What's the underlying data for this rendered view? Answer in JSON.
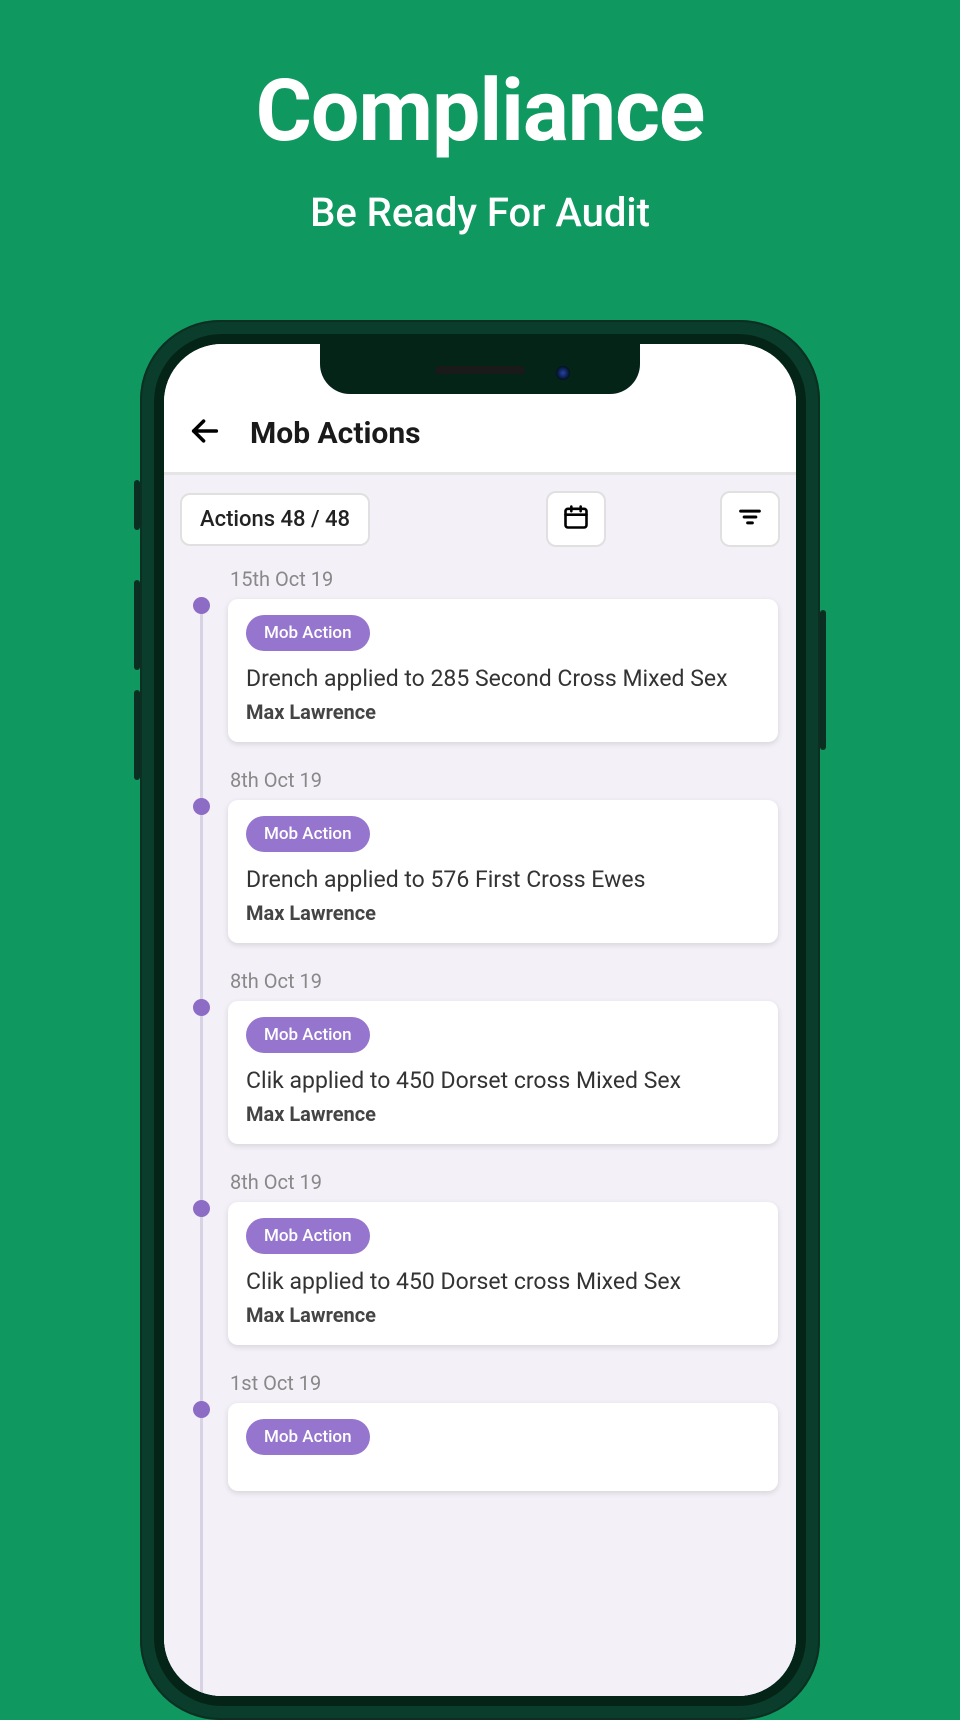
{
  "hero": {
    "title": "Compliance",
    "subtitle": "Be Ready For Audit"
  },
  "app": {
    "title": "Mob Actions",
    "counter": "Actions 48 / 48"
  },
  "entries": [
    {
      "date": "15th Oct 19",
      "pill": "Mob Action",
      "desc": "Drench applied to 285 Second Cross Mixed Sex",
      "author": "Max Lawrence"
    },
    {
      "date": "8th Oct 19",
      "pill": "Mob Action",
      "desc": "Drench applied to 576 First Cross Ewes",
      "author": "Max Lawrence"
    },
    {
      "date": "8th Oct 19",
      "pill": "Mob Action",
      "desc": "Clik applied to 450 Dorset cross Mixed Sex",
      "author": "Max Lawrence"
    },
    {
      "date": "8th Oct 19",
      "pill": "Mob Action",
      "desc": "Clik applied to 450 Dorset cross Mixed Sex",
      "author": "Max Lawrence"
    },
    {
      "date": "1st Oct 19",
      "pill": "Mob Action",
      "desc": "",
      "author": ""
    }
  ]
}
